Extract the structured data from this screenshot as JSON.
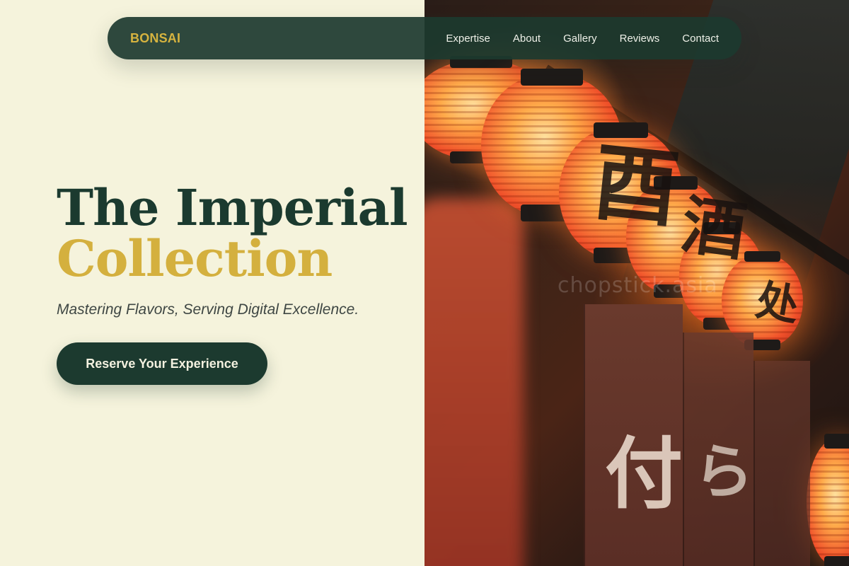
{
  "nav": {
    "brand": "BONSAI",
    "links": [
      "Expertise",
      "About",
      "Gallery",
      "Reviews",
      "Contact"
    ]
  },
  "hero": {
    "title_line1": "The Imperial",
    "title_line2": "Collection",
    "tagline": "Mastering Flavors, Serving Digital Excellence.",
    "cta_label": "Reserve Your Experience"
  },
  "photo": {
    "watermark": "chopstick.asia"
  },
  "colors": {
    "primary": "#1c3a2f",
    "accent": "#d4b03e",
    "background": "#f5f3dc"
  }
}
